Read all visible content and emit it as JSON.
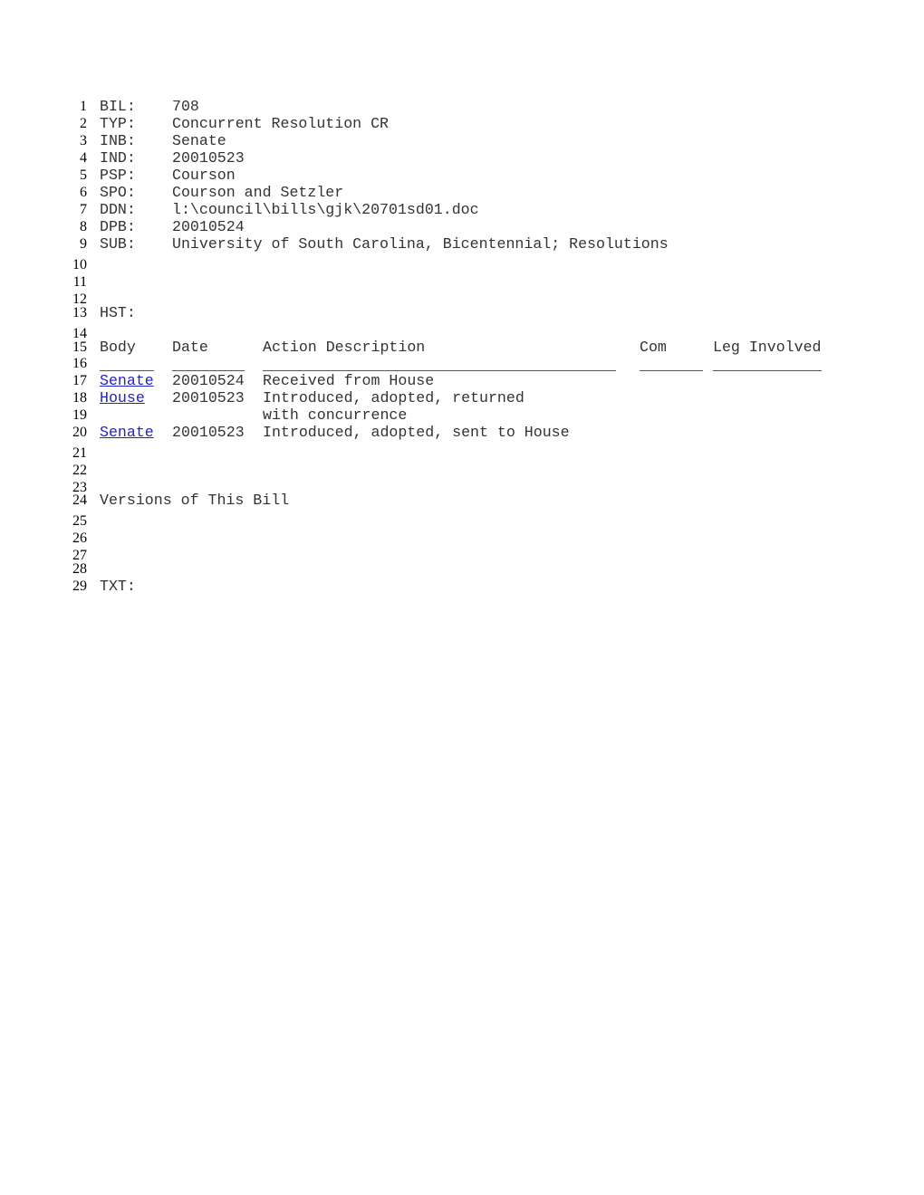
{
  "header_fields": [
    {
      "line": "1",
      "key": "BIL:",
      "value": "708"
    },
    {
      "line": "2",
      "key": "TYP:",
      "value": "Concurrent Resolution CR"
    },
    {
      "line": "3",
      "key": "INB:",
      "value": "Senate"
    },
    {
      "line": "4",
      "key": "IND:",
      "value": "20010523"
    },
    {
      "line": "5",
      "key": "PSP:",
      "value": "Courson"
    },
    {
      "line": "6",
      "key": "SPO:",
      "value": "Courson and Setzler"
    },
    {
      "line": "7",
      "key": "DDN:",
      "value": "l:\\council\\bills\\gjk\\20701sd01.doc"
    },
    {
      "line": "8",
      "key": "DPB:",
      "value": "20010524"
    },
    {
      "line": "9",
      "key": "SUB:",
      "value": "University of South Carolina, Bicentennial; Resolutions"
    }
  ],
  "line_numbers": [
    "1",
    "2",
    "3",
    "4",
    "5",
    "6",
    "7",
    "8",
    "9",
    "10",
    "11",
    "12",
    "13",
    "14",
    "15",
    "16",
    "17",
    "18",
    "19",
    "20",
    "21",
    "22",
    "23",
    "24",
    "25",
    "26",
    "27",
    "28",
    "29"
  ],
  "history": {
    "label": "HST:",
    "columns": [
      "Body",
      "Date",
      "Action Description",
      "Com",
      "Leg Involved"
    ],
    "rows": [
      {
        "body": "Senate",
        "date": "20010524",
        "action": "Received from House",
        "action_cont": ""
      },
      {
        "body": "House",
        "date": "20010523",
        "action": "Introduced, adopted, returned",
        "action_cont": "with concurrence"
      },
      {
        "body": "Senate",
        "date": "20010523",
        "action": "Introduced, adopted, sent to House",
        "action_cont": ""
      }
    ]
  },
  "versions_label": "Versions of This Bill",
  "text_label": "TXT:",
  "colors": {
    "link": "#2222cc",
    "text": "#333333"
  }
}
